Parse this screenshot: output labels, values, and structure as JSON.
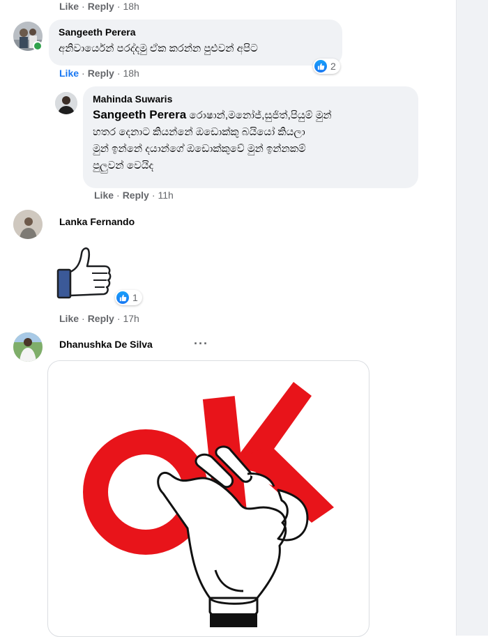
{
  "colors": {
    "link_blue": "#1877f2",
    "muted": "#65676b",
    "bubble_bg": "#f0f2f5",
    "online_green": "#31a24c",
    "ok_red": "#e8141a"
  },
  "top_actions": {
    "like": "Like",
    "reply": "Reply",
    "time": "18h"
  },
  "comments": [
    {
      "author": "Sangeeth Perera",
      "text": "අනිවාර්යෙන් පරද්දමු ඒක කරන්න පුළුවන් අපිට",
      "like": "Like",
      "reply": "Reply",
      "time": "18h",
      "reaction_count": "2"
    },
    {
      "author": "Mahinda Suwaris",
      "mention": "Sangeeth Perera",
      "line1": "රොෂාන්,මනෝජ්,සුජිත්,පියුම් මුන්",
      "line2": "හතර දෙනාට කියන්නේ ඔඩොක්කු බයියෝ කියලා",
      "line3": "මුන් ඉන්නේ දයාන්ගේ ඔඩොක්කුවේ මුන් ඉන්නකම්",
      "line4": "පුලුවන් වෙයිද",
      "like": "Like",
      "reply": "Reply",
      "time": "11h"
    },
    {
      "author": "Lanka Fernando",
      "sticker": "thumbs-up",
      "like": "Like",
      "reply": "Reply",
      "time": "17h",
      "reaction_count": "1"
    },
    {
      "author": "Dhanushka De Silva",
      "more": "···",
      "sticker": "ok-hand"
    }
  ]
}
